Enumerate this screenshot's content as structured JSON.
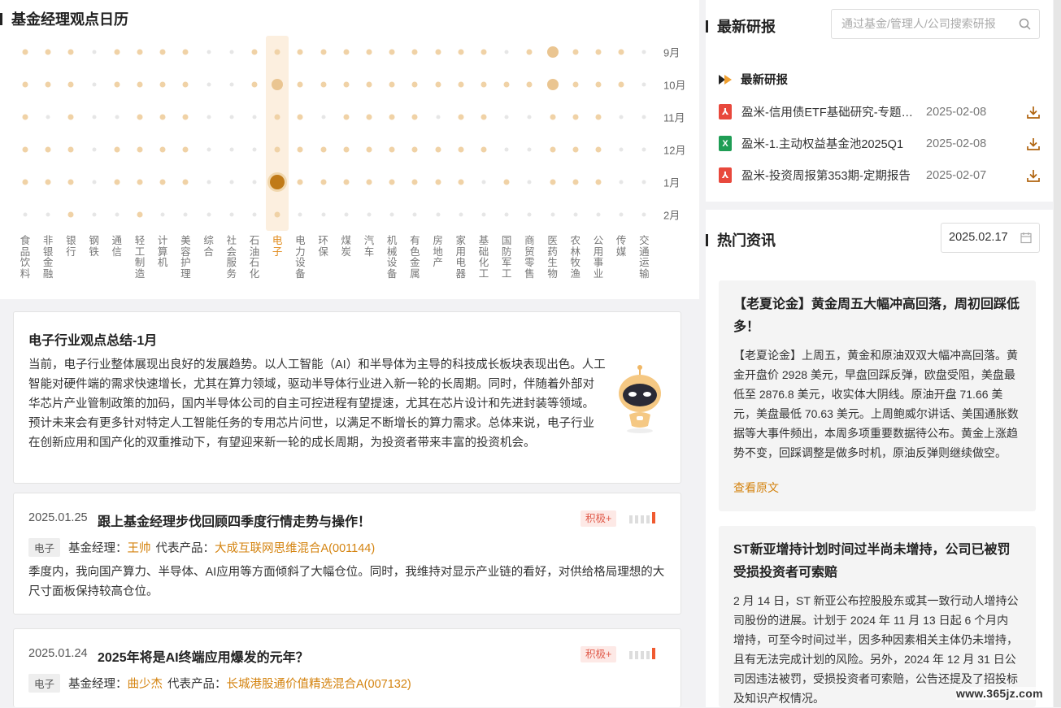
{
  "calendar": {
    "title": "基金经理观点日历",
    "months": [
      "9月",
      "10月",
      "11月",
      "12月",
      "1月",
      "2月"
    ],
    "industries": [
      "食品饮料",
      "非银金融",
      "银行",
      "钢铁",
      "通信",
      "轻工制造",
      "计算机",
      "美容护理",
      "综合",
      "社会服务",
      "石油石化",
      "电子",
      "电力设备",
      "环保",
      "煤炭",
      "汽车",
      "机械设备",
      "有色金属",
      "房地产",
      "家用电器",
      "基础化工",
      "国防军工",
      "商贸零售",
      "医药生物",
      "农林牧渔",
      "公用事业",
      "传媒",
      "交通运输"
    ],
    "active_industry": "电子",
    "levels": [
      [
        2,
        2,
        2,
        1,
        2,
        2,
        2,
        2,
        1,
        1,
        2,
        2,
        2,
        2,
        2,
        2,
        2,
        2,
        2,
        2,
        2,
        1,
        2,
        3,
        2,
        2,
        2,
        1
      ],
      [
        2,
        2,
        2,
        1,
        2,
        2,
        2,
        2,
        1,
        1,
        2,
        3,
        2,
        2,
        2,
        2,
        2,
        2,
        2,
        2,
        2,
        2,
        2,
        3,
        2,
        2,
        2,
        1
      ],
      [
        2,
        1,
        2,
        1,
        1,
        2,
        2,
        2,
        1,
        1,
        1,
        2,
        2,
        1,
        2,
        2,
        2,
        2,
        1,
        2,
        2,
        1,
        1,
        2,
        2,
        2,
        1,
        1
      ],
      [
        2,
        2,
        2,
        1,
        2,
        2,
        2,
        2,
        1,
        1,
        1,
        2,
        2,
        2,
        2,
        2,
        2,
        2,
        2,
        2,
        2,
        1,
        1,
        2,
        2,
        2,
        1,
        1
      ],
      [
        2,
        2,
        2,
        1,
        2,
        2,
        2,
        2,
        1,
        1,
        1,
        4,
        2,
        2,
        2,
        2,
        2,
        2,
        2,
        2,
        1,
        2,
        1,
        2,
        2,
        2,
        1,
        1
      ],
      [
        1,
        1,
        2,
        1,
        1,
        2,
        1,
        1,
        1,
        1,
        1,
        2,
        1,
        1,
        1,
        1,
        1,
        1,
        1,
        1,
        1,
        1,
        1,
        1,
        1,
        1,
        1,
        1
      ]
    ]
  },
  "summary": {
    "title": "电子行业观点总结-1月",
    "text": "当前，电子行业整体展现出良好的发展趋势。以人工智能（AI）和半导体为主导的科技成长板块表现出色。人工智能对硬件端的需求快速增长，尤其在算力领域，驱动半导体行业进入新一轮的长周期。同时，伴随着外部对华芯片产业管制政策的加码，国内半导体公司的自主可控进程有望提速，尤其在芯片设计和先进封装等领域。预计未来会有更多针对特定人工智能任务的专用芯片问世，以满足不断增长的算力需求。总体来说，电子行业在创新应用和国产化的双重推动下，有望迎来新一轮的成长周期，为投资者带来丰富的投资机会。"
  },
  "posts": [
    {
      "date": "2025.01.25",
      "title": "跟上基金经理步伐回顾四季度行情走势与操作！",
      "sentiment": "积极+",
      "industry_tag": "电子",
      "manager_label": "基金经理：",
      "manager": "王帅",
      "product_label": "代表产品：",
      "product": "大成互联网思维混合A(001144)",
      "body": "季度内，我向国产算力、半导体、AI应用等方面倾斜了大幅仓位。同时，我维持对显示产业链的看好，对供给格局理想的大尺寸面板保持较高仓位。"
    },
    {
      "date": "2025.01.24",
      "title": "2025年将是AI终端应用爆发的元年？",
      "sentiment": "积极+",
      "industry_tag": "电子",
      "manager_label": "基金经理：",
      "manager": "曲少杰",
      "product_label": "代表产品：",
      "product": "长城港股通价值精选混合A(007132)"
    }
  ],
  "research": {
    "title": "最新研报",
    "search_placeholder": "通过基金/管理人/公司搜索研报",
    "sub_title": "最新研报",
    "items": [
      {
        "type": "pdf",
        "name": "盈米-信用债ETF基础研究-专题报告",
        "date": "2025-02-08"
      },
      {
        "type": "xls",
        "name": "盈米-1.主动权益基金池2025Q1",
        "date": "2025-02-08"
      },
      {
        "type": "pdf",
        "name": "盈米-投资周报第353期-定期报告",
        "date": "2025-02-07"
      }
    ]
  },
  "news": {
    "title": "热门资讯",
    "date": "2025.02.17",
    "items": [
      {
        "title": "【老夏论金】黄金周五大幅冲高回落，周初回踩低多！",
        "text": "【老夏论金】上周五，黄金和原油双双大幅冲高回落。黄金开盘价 2928 美元，早盘回踩反弹，欧盘受阻，美盘最低至 2876.8 美元，收实体大阴线。原油开盘 71.66 美元，美盘最低 70.63 美元。上周鲍威尔讲话、美国通胀数据等大事件频出，本周多项重要数据待公布。黄金上涨趋势不变，回踩调整是做多时机，原油反弹则继续做空。",
        "more": "查看原文"
      },
      {
        "title": "ST新亚增持计划时间过半尚未增持，公司已被罚受损投资者可索赔",
        "text": "2 月 14 日，ST 新亚公布控股股东或其一致行动人增持公司股份的进展。计划于 2024 年 11 月 13 日起 6 个月内增持，可至今时间过半，因多种因素相关主体仍未增持，且有无法完成计划的风险。另外，2024 年 12 月 31 日公司因违法被罚，受损投资者可索赔，公告还提及了招投标及知识产权情况。"
      }
    ]
  },
  "watermark": "www.365jz.com",
  "colors": {
    "accent": "#d4830f",
    "dot_low": "#e6e6e6",
    "dot_mid": "#f0d2a6",
    "dot_high": "#eac591",
    "dot_active": "#c07a18"
  }
}
